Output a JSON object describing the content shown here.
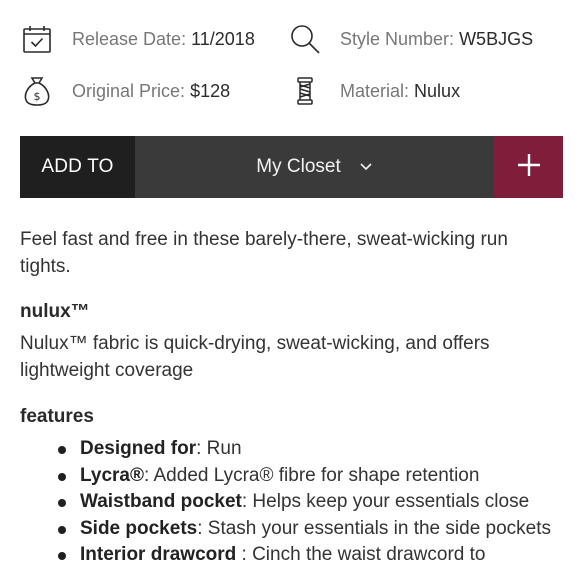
{
  "meta": {
    "release": {
      "label": "Release Date:",
      "value": "11/2018",
      "icon": "calendar-icon"
    },
    "style": {
      "label": "Style Number:",
      "value": "W5BJGS",
      "icon": "search-icon"
    },
    "price": {
      "label": "Original Price:",
      "value": "$128",
      "icon": "money-bag-icon"
    },
    "material": {
      "label": "Material:",
      "value": "Nulux",
      "icon": "thread-spool-icon"
    }
  },
  "addbar": {
    "add_to_label": "ADD TO",
    "closet_label": "My Closet",
    "plus_label": "+",
    "colors": {
      "dark": "#1f1f1f",
      "mid": "#3a3a3a",
      "accent": "#7f1d3a"
    }
  },
  "description": "Feel fast and free in these barely-there, sweat-wicking run tights.",
  "fabric": {
    "heading": "nulux™",
    "text": "Nulux™ fabric is quick-drying, sweat-wicking, and offers lightweight coverage"
  },
  "features": {
    "heading": "features",
    "items": [
      {
        "term": "Designed for",
        "text": ": Run"
      },
      {
        "term": "Lycra®",
        "text": ": Added Lycra® fibre for shape retention"
      },
      {
        "term": "Waistband pocket",
        "text": ": Helps keep your essentials close"
      },
      {
        "term": "Side pockets",
        "text": ": Stash your essentials in the side pockets"
      },
      {
        "term": "Interior drawcord",
        "text": " : Cinch the waist drawcord to"
      }
    ]
  }
}
